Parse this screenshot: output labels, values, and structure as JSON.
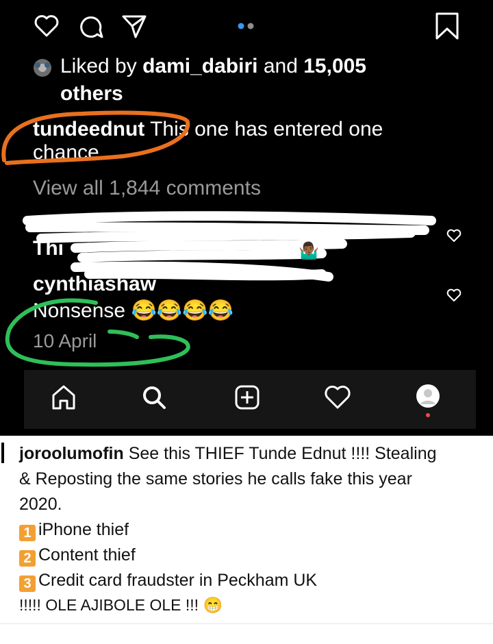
{
  "post": {
    "likes_prefix": "Liked by",
    "likes_user": "dami_dabiri",
    "likes_and": "and",
    "likes_count": "15,005",
    "likes_others": "others",
    "author": "tundeednut",
    "caption_line1": "This one has entered one",
    "caption_line2": "chance.",
    "view_comments": "View all 1,844 comments",
    "comment2_user": "cynthiashaw",
    "comment2_text": "Nonsense",
    "comment2_emoji": "😂😂😂😂",
    "date": "10 April",
    "carousel_dots": 2,
    "active_dot": 1
  },
  "nav": {
    "items": [
      "home",
      "search",
      "add",
      "activity",
      "profile"
    ]
  },
  "repost": {
    "user": "joroolumofin",
    "line1": "See this THIEF Tunde Ednut !!!! Stealing",
    "line2": "& Reposting the same stories he calls fake this year",
    "line3": "2020.",
    "items": [
      {
        "num": "1",
        "text": "iPhone thief"
      },
      {
        "num": "2",
        "text": "Content thief"
      },
      {
        "num": "3",
        "text": "Credit card fraudster in Peckham UK"
      }
    ],
    "closing": "!!!!! OLE AJIBOLE OLE !!!",
    "closing_emoji": "😁"
  },
  "colors": {
    "background": "#000000",
    "accent_blue": "#3897f0",
    "orange_markup": "#e8701f",
    "green_markup": "#2fbf59",
    "number_badge": "#f2a033",
    "notification_dot": "#ed4956"
  }
}
